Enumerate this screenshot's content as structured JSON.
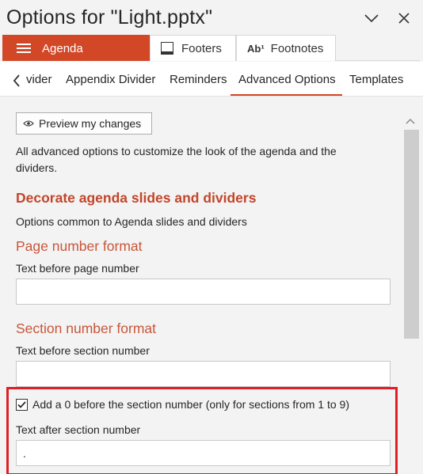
{
  "window": {
    "title": "Options for \"Light.pptx\""
  },
  "top_tabs": [
    {
      "label": "Agenda",
      "icon": "hamburger-icon"
    },
    {
      "label": "Footers",
      "icon": "footer-icon"
    },
    {
      "label": "Footnotes",
      "icon": "footnote-icon",
      "icon_text": "Ab¹"
    }
  ],
  "sub_tabs": [
    {
      "label": "vider"
    },
    {
      "label": "Appendix Divider"
    },
    {
      "label": "Reminders"
    },
    {
      "label": "Advanced Options"
    },
    {
      "label": "Templates"
    }
  ],
  "active_sub_tab": "Advanced Options",
  "main": {
    "preview_button": "Preview my changes",
    "intro": "All advanced options to customize the look of the agenda and the dividers.",
    "section_heading": "Decorate agenda slides and dividers",
    "section_desc": "Options common to Agenda slides and dividers",
    "page_number_heading": "Page number format",
    "text_before_page_label": "Text before page number",
    "text_before_page_value": "",
    "section_number_heading": "Section number format",
    "text_before_section_label": "Text before section number",
    "text_before_section_value": "",
    "add_zero_checkbox": {
      "label": "Add a 0 before the section number (only for sections from 1 to 9)",
      "checked": true
    },
    "text_after_section_label": "Text after section number",
    "text_after_section_value": "."
  },
  "colors": {
    "accent": "#d24726",
    "heading": "#c2462a",
    "highlight": "#e01e25"
  }
}
